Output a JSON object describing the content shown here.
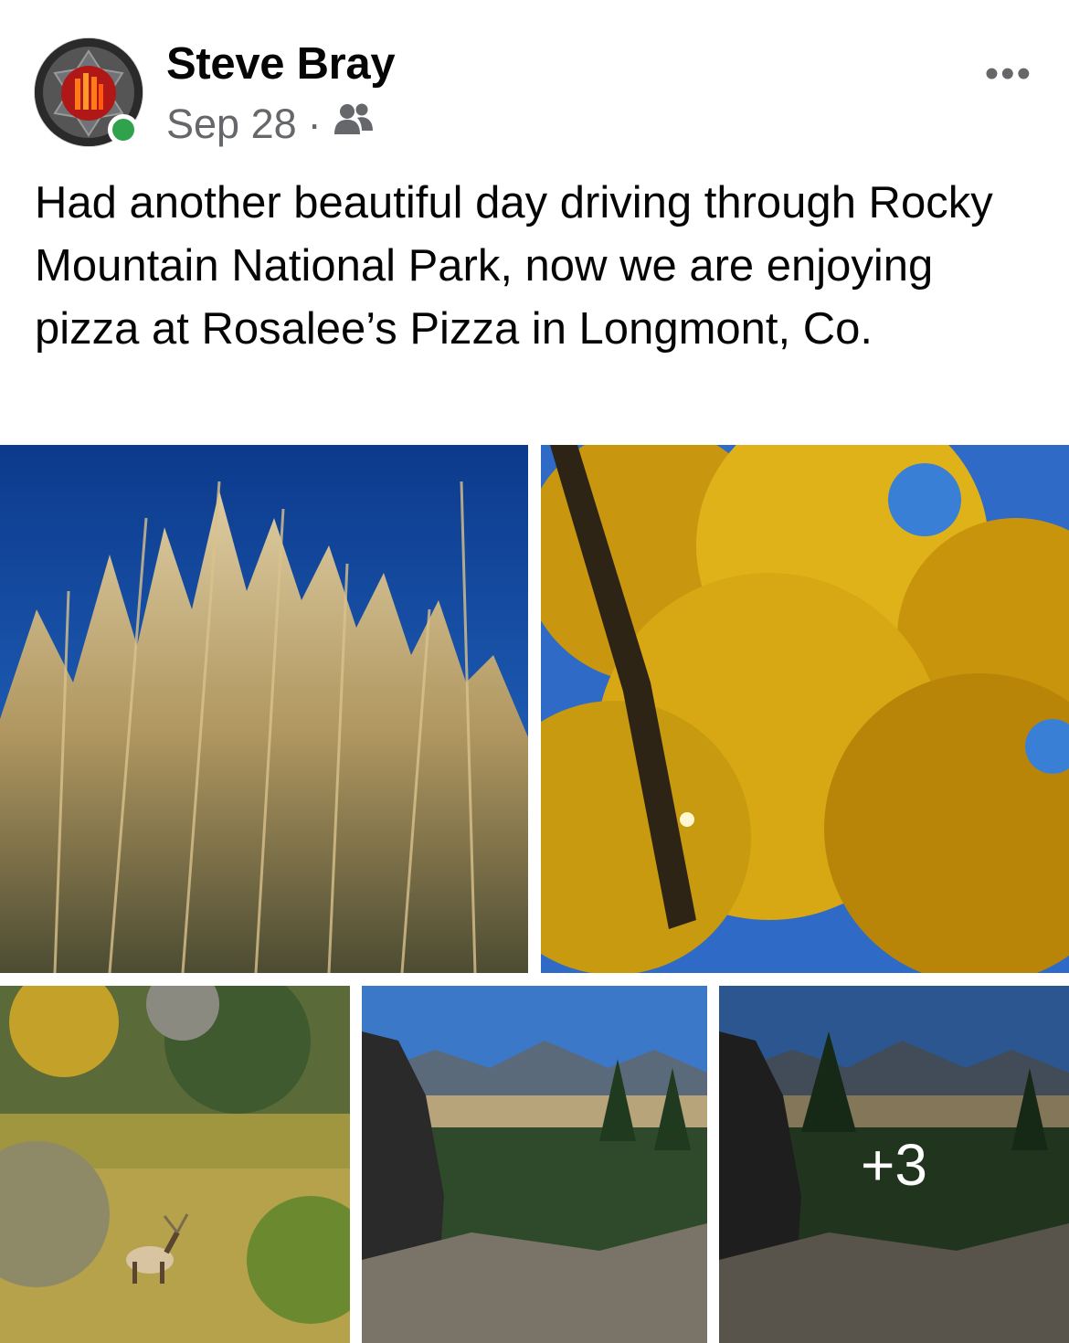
{
  "post": {
    "author": "Steve Bray",
    "date": "Sep 28",
    "separator": "·",
    "audience_icon": "friends-icon",
    "more_label": "•••",
    "online_status": "online",
    "text": "Had another beautiful day driving through Rocky Mountain National Park, now we are enjoying pizza at Rosalee’s Pizza in Longmont, Co."
  },
  "photos": {
    "items": [
      {
        "subject": "tall grass against blue sky"
      },
      {
        "subject": "yellow autumn tree"
      },
      {
        "subject": "elk in meadow"
      },
      {
        "subject": "mountain overlook"
      },
      {
        "subject": "mountain overlook"
      }
    ],
    "more_count_label": "+3"
  },
  "colors": {
    "online": "#31a24c",
    "secondary_text": "#65676b"
  }
}
